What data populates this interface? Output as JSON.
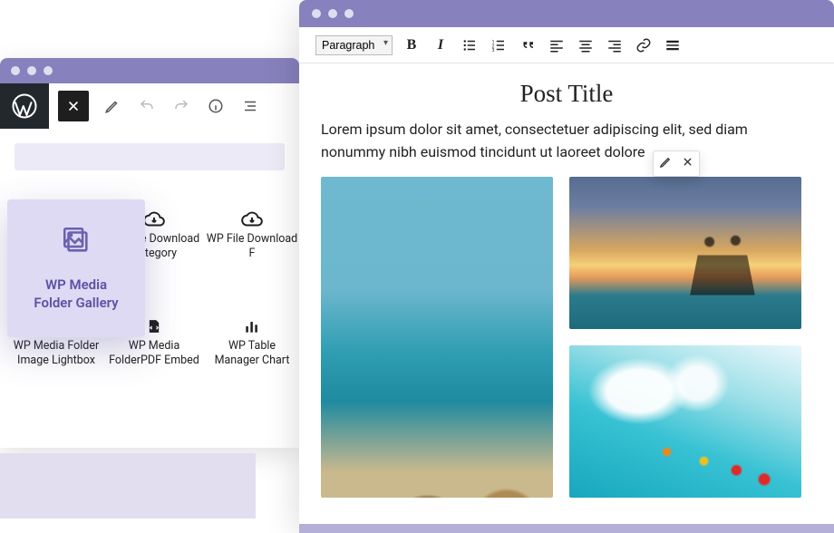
{
  "left": {
    "selected_block": {
      "label_line1": "WP Media",
      "label_line2": "Folder Gallery"
    },
    "blocks": [
      {
        "label": "WP File Download Category"
      },
      {
        "label": "WP File Download F"
      },
      {
        "label": "WP Media Folder Image Lightbox"
      },
      {
        "label": "WP Media FolderPDF Embed"
      },
      {
        "label": "WP Table Manager Chart"
      }
    ]
  },
  "right": {
    "format_selected": "Paragraph",
    "post_title": "Post Title",
    "post_body": "Lorem ipsum dolor sit amet, consectetuer adipiscing elit, sed diam nonummy nibh euismod tincidunt ut laoreet dolore"
  }
}
